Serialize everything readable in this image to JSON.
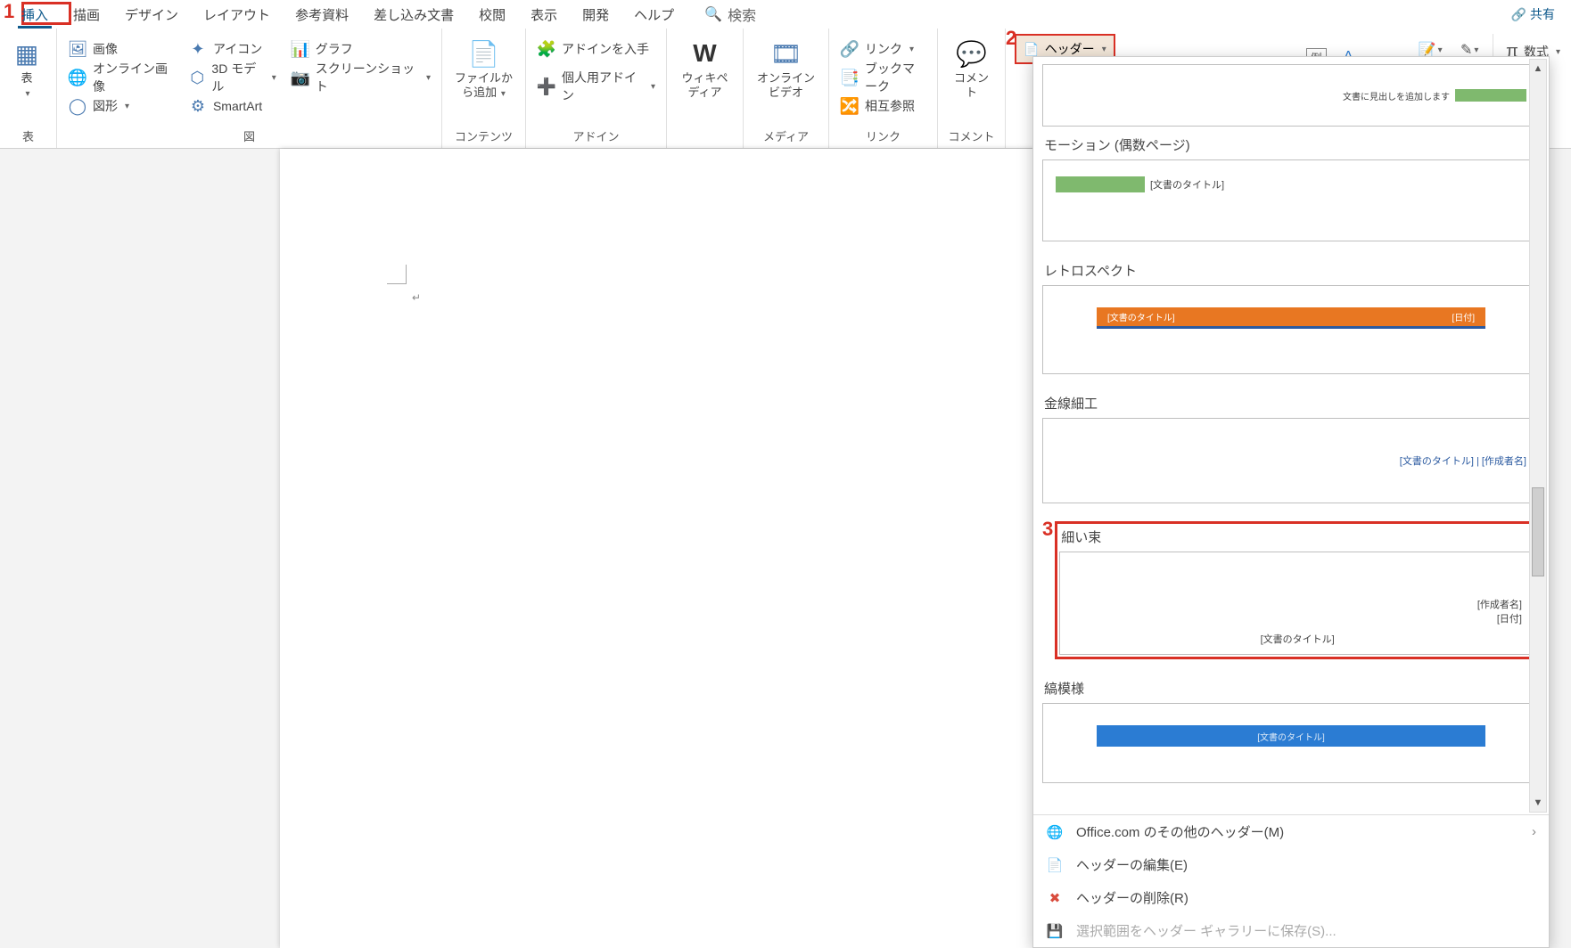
{
  "tabs": {
    "insert": "挿入",
    "draw": "描画",
    "design": "デザイン",
    "layout": "レイアウト",
    "references": "参考資料",
    "mailings": "差し込み文書",
    "review": "校閲",
    "view": "表示",
    "developer": "開発",
    "help": "ヘルプ"
  },
  "search_label": "検索",
  "share_label": "共有",
  "ribbon": {
    "tables": {
      "label": "表",
      "big": "表"
    },
    "illustrations": {
      "label": "図",
      "items": {
        "picture": "画像",
        "online_pic": "オンライン画像",
        "shapes": "図形",
        "icons": "アイコン",
        "threeD": "3D モデル",
        "smartart": "SmartArt",
        "chart": "グラフ",
        "screenshot": "スクリーンショット"
      }
    },
    "content": {
      "label": "コンテンツ",
      "big": "ファイルから追加"
    },
    "addins": {
      "label": "アドイン",
      "get": "アドインを入手",
      "my": "個人用アドイン"
    },
    "media_wiki": {
      "label": "ウィキペディア"
    },
    "media": {
      "label": "メディア",
      "video": "オンラインビデオ"
    },
    "links": {
      "label": "リンク",
      "link": "リンク",
      "bookmark": "ブックマーク",
      "cross": "相互参照"
    },
    "comments": {
      "label": "コメント",
      "big": "コメント"
    },
    "header_btn": "ヘッダー",
    "equation": "数式",
    "example": "例"
  },
  "gallery": {
    "first_note": "文書に見出しを追加します",
    "items": {
      "motion_even": "モーション (偶数ページ)",
      "retrospect": "レトロスペクト",
      "filigree": "金線細工",
      "thin_bundle": "細い束",
      "stripes": "縞模様"
    },
    "tokens": {
      "doc_title": "[文書のタイトル]",
      "author": "[作成者名]",
      "date": "[日付]",
      "title_author": "[文書のタイトル] | [作成者名]"
    },
    "footer": {
      "more": "Office.com のその他のヘッダー(M)",
      "edit": "ヘッダーの編集(E)",
      "remove": "ヘッダーの削除(R)",
      "save": "選択範囲をヘッダー ギャラリーに保存(S)..."
    }
  },
  "callouts": {
    "c1": "1",
    "c2": "2",
    "c3": "3"
  }
}
